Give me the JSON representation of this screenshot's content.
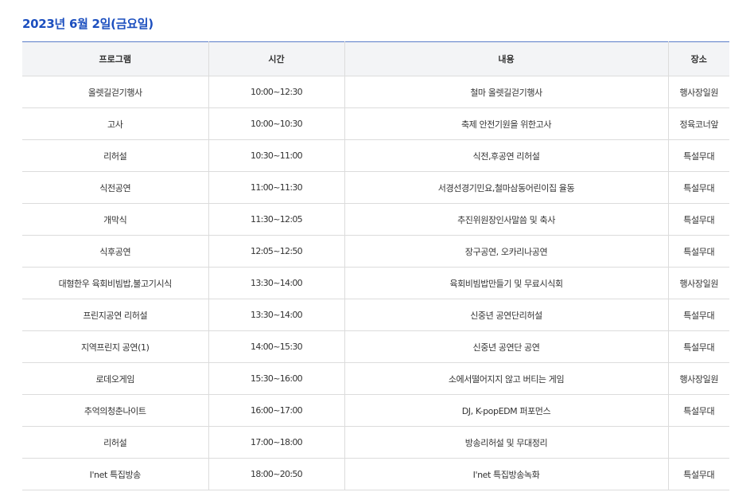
{
  "title": "2023년 6월 2일(금요일)",
  "table": {
    "headers": {
      "program": "프로그램",
      "time": "시간",
      "content": "내용",
      "place": "장소"
    },
    "rows": [
      {
        "program": "올렛길걷기행사",
        "time": "10:00~12:30",
        "content": "철마 올렛길걷기행사",
        "place": "행사장일원"
      },
      {
        "program": "고사",
        "time": "10:00~10:30",
        "content": "축제 안전기원을 위한고사",
        "place": "정육코너앞"
      },
      {
        "program": "리허설",
        "time": "10:30~11:00",
        "content": "식전,후공연 리허설",
        "place": "특설무대"
      },
      {
        "program": "식전공연",
        "time": "11:00~11:30",
        "content": "서경선경기민요,철마삼동어린이집 율동",
        "place": "특설무대"
      },
      {
        "program": "개막식",
        "time": "11:30~12:05",
        "content": "추진위원장인사말씀 및 축사",
        "place": "특설무대"
      },
      {
        "program": "식후공연",
        "time": "12:05~12:50",
        "content": "장구공연, 오카리나공연",
        "place": "특설무대"
      },
      {
        "program": "대형한우 육회비빔밥,불고기시식",
        "time": "13:30~14:00",
        "content": "육회비빔밥만들기 및 무료시식회",
        "place": "행사장일원"
      },
      {
        "program": "프린지공연 리허설",
        "time": "13:30~14:00",
        "content": "신중년 공연단리허설",
        "place": "특설무대"
      },
      {
        "program": "지역프린지 공연(1)",
        "time": "14:00~15:30",
        "content": "신중년 공연단 공연",
        "place": "특설무대"
      },
      {
        "program": "로데오게임",
        "time": "15:30~16:00",
        "content": "소에서떨어지지 않고 버티는 게임",
        "place": "행사장일원"
      },
      {
        "program": "추억의청춘나이트",
        "time": "16:00~17:00",
        "content": "DJ, K-popEDM 퍼포먼스",
        "place": "특설무대"
      },
      {
        "program": "리허설",
        "time": "17:00~18:00",
        "content": "방송리허설 및 무대정리",
        "place": ""
      },
      {
        "program": "I'net 특집방송",
        "time": "18:00~20:50",
        "content": "I'net 특집방송녹화",
        "place": "특설무대"
      }
    ]
  },
  "colors": {
    "title": "#1c4fbf",
    "header_background": "#f3f4f6",
    "top_rule": "#5a7cc8",
    "grid_lines": "#dcdcdc"
  }
}
